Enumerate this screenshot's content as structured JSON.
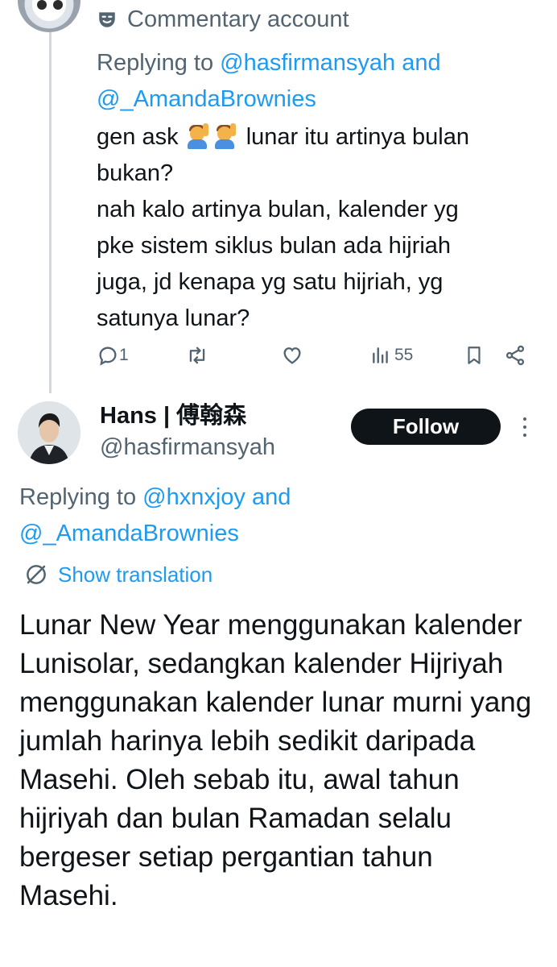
{
  "tweet1": {
    "label": "Commentary account",
    "replying_prefix": "Replying to ",
    "mention1": "@hasfirmansyah",
    "and_word": " and",
    "mention2": "@_AmandaBrownies",
    "text_part1": "gen ask ",
    "emoji": "🙋‍♂️🙋‍♂️",
    "text_part2": " lunar itu artinya bulan\nbukan?\nnah kalo artinya bulan, kalender yg\npke sistem siklus bulan ada hijriah\njuga, jd kenapa yg satu hijriah, yg\nsatunya lunar?",
    "replies": "1",
    "retweets": "",
    "likes": "",
    "views": "55"
  },
  "tweet2": {
    "name": "Hans | 傅翰森",
    "handle": "@hasfirmansyah",
    "follow_label": "Follow",
    "replying_prefix": "Replying to ",
    "mention1": "@hxnxjoy",
    "and_word": " and",
    "mention2": "@_AmandaBrownies",
    "show_translation": "Show translation",
    "text": "Lunar New Year menggunakan kalender Lunisolar, sedangkan kalender Hijriyah menggunakan kalender lunar murni yang jumlah harinya lebih sedikit daripada Masehi. Oleh sebab itu, awal tahun hijriyah dan bulan Ramadan selalu bergeser setiap pergantian tahun Masehi."
  },
  "colors": {
    "text": "#0f1419",
    "secondary": "#536471",
    "link": "#1d9bf0",
    "thread_line": "#cfd9de",
    "follow_bg": "#0f1419"
  },
  "icons": [
    "theater-mask-icon",
    "reply-icon",
    "retweet-icon",
    "like-icon",
    "views-icon",
    "bookmark-icon",
    "share-icon",
    "more-dots-icon",
    "translate-icon"
  ]
}
